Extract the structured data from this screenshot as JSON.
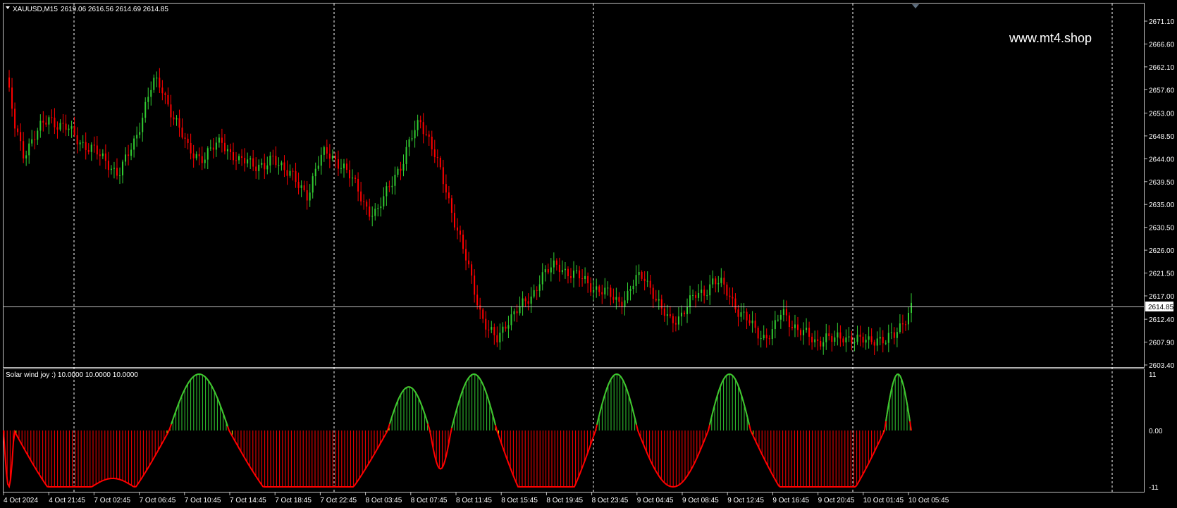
{
  "symbol_bar": {
    "symbol": "XAUUSD,M15",
    "ohlc": "2619.06 2616.56 2614.69 2614.85"
  },
  "watermark": "www.mt4.shop",
  "indicator": {
    "title": "Solar wind joy :) 10.0000 10.0000 10.0000"
  },
  "colors": {
    "background": "#000000",
    "up_candle": "#32cd32",
    "down_candle": "#ff0000",
    "indicator_up": "#32cd32",
    "indicator_down": "#ff0000",
    "indicator_transition": "#ffff00",
    "grid": "#ffffff",
    "bid_line": "#c0c0c0"
  },
  "chart_data": [
    {
      "type": "candlestick",
      "title": "XAUUSD,M15",
      "price_axis_ticks": [
        "2671.10",
        "2666.60",
        "2662.10",
        "2657.60",
        "2653.00",
        "2648.50",
        "2644.00",
        "2639.50",
        "2635.00",
        "2630.50",
        "2626.00",
        "2621.50",
        "2617.00",
        "2612.40",
        "2607.90",
        "2603.40"
      ],
      "current_price": "2614.85",
      "ylim": [
        2603.4,
        2671.1
      ],
      "time_axis_ticks": [
        "4 Oct 2024",
        "4 Oct 21:45",
        "7 Oct 02:45",
        "7 Oct 06:45",
        "7 Oct 10:45",
        "7 Oct 14:45",
        "7 Oct 18:45",
        "7 Oct 22:45",
        "8 Oct 03:45",
        "8 Oct 07:45",
        "8 Oct 11:45",
        "8 Oct 15:45",
        "8 Oct 19:45",
        "8 Oct 23:45",
        "9 Oct 04:45",
        "9 Oct 08:45",
        "9 Oct 12:45",
        "9 Oct 16:45",
        "9 Oct 20:45",
        "10 Oct 01:45",
        "10 Oct 05:45"
      ],
      "close_path": [
        2660,
        2650,
        2645,
        2648,
        2650,
        2652,
        2651,
        2650,
        2648,
        2647,
        2646,
        2644,
        2643,
        2641,
        2644,
        2648,
        2654,
        2659,
        2658,
        2654,
        2650,
        2646,
        2645,
        2644,
        2646,
        2648,
        2645,
        2643,
        2644,
        2643,
        2642,
        2644,
        2643,
        2641,
        2638,
        2637,
        2643,
        2645,
        2644,
        2643,
        2640,
        2637,
        2634,
        2633,
        2637,
        2641,
        2643,
        2648,
        2652,
        2648,
        2643,
        2638,
        2632,
        2626,
        2620,
        2614,
        2610,
        2608,
        2612,
        2614,
        2615,
        2617,
        2621,
        2622,
        2623,
        2622,
        2621,
        2620,
        2619,
        2618,
        2617,
        2616,
        2617,
        2620,
        2621,
        2618,
        2614,
        2612,
        2613,
        2615,
        2617,
        2618,
        2620,
        2619,
        2617,
        2614,
        2612,
        2610,
        2609,
        2610,
        2614,
        2612,
        2610,
        2609,
        2608,
        2609,
        2608,
        2609,
        2609,
        2608,
        2608,
        2609,
        2608,
        2609,
        2612,
        2614.85
      ]
    },
    {
      "type": "histogram",
      "title": "Solar wind joy :) 10.0000 10.0000 10.0000",
      "axis_ticks": [
        "11",
        "0.00",
        "-11"
      ],
      "ylim": [
        -11,
        11
      ]
    }
  ]
}
